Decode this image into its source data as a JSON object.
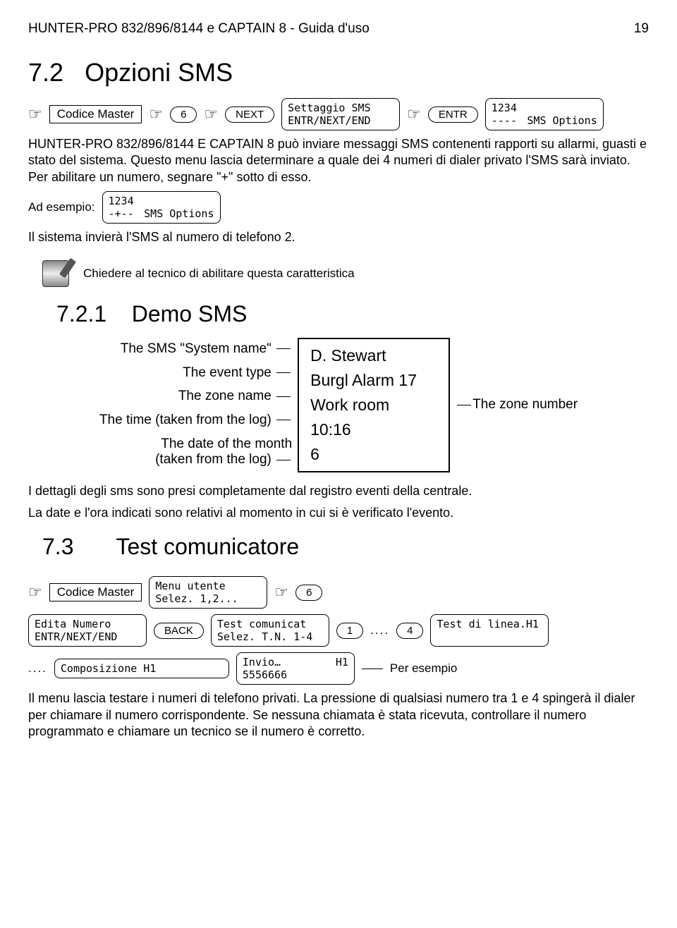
{
  "header": {
    "title": "HUNTER-PRO 832/896/8144 e CAPTAIN 8 - Guida d'uso",
    "page": "19"
  },
  "s72": {
    "heading_num": "7.2",
    "heading_text": "Opzioni SMS",
    "codice_master": "Codice Master",
    "key6": "6",
    "keyNext": "NEXT",
    "lcd1_line1": "Settaggio SMS",
    "lcd1_line2": "ENTR/NEXT/END",
    "keyEntr": "ENTR",
    "lcd2_line1": "1234",
    "lcd2_line2a": "----",
    "lcd2_line2b": "SMS Options",
    "para1": "HUNTER-PRO 832/896/8144 E CAPTAIN 8 può inviare messaggi SMS contenenti rapporti su allarmi, guasti e stato del sistema. Questo menu lascia determinare a quale dei 4 numeri di dialer privato l'SMS sarà inviato. Per abilitare un numero, segnare \"+\" sotto di esso.",
    "ad_esempio": "Ad esempio:",
    "lcd3_line1": "1234",
    "lcd3_line2a": "-+--",
    "lcd3_line2b": "SMS Options",
    "para2": "Il sistema invierà l'SMS al numero di telefono 2.",
    "note": "Chiedere al tecnico di abilitare questa caratteristica"
  },
  "s721": {
    "heading_num": "7.2.1",
    "heading_text": "Demo SMS",
    "demo": {
      "left": [
        "The SMS \"System name\"",
        "The event type",
        "The zone name",
        "The time (taken from the log)",
        "The date of the month\n(taken from the log)"
      ],
      "box": [
        "D. Stewart",
        "Burgl Alarm 17",
        "Work room",
        "10:16",
        "6"
      ],
      "right": "The zone number"
    },
    "para1": "I dettagli degli sms sono presi completamente dal registro eventi della centrale.",
    "para2": "La date e l'ora indicati sono relativi al momento in cui si è verificato l'evento."
  },
  "s73": {
    "heading_num": "7.3",
    "heading_text": "Test comunicatore",
    "codice_master": "Codice Master",
    "lcd1_line1": "Menu utente",
    "lcd1_line2": "Selez. 1,2...",
    "key6": "6",
    "lcd2_line1": "Edita Numero",
    "lcd2_line2": "ENTR/NEXT/END",
    "keyBack": "BACK",
    "lcd3_line1": "Test comunicat",
    "lcd3_line2": "Selez. T.N. 1-4",
    "key1": "1",
    "dots1": "....",
    "key4": "4",
    "lcd4_line1": "Test di linea.H1",
    "dots2": "....",
    "lcd5_line1": "Composizione H1",
    "lcd6_line1a": "Invio…",
    "lcd6_line1b": "H1",
    "lcd6_line2": "5556666",
    "per_esempio": "Per esempio",
    "para": "Il menu lascia testare i numeri di telefono privati. La pressione di qualsiasi numero tra 1 e 4 spingerà il dialer per chiamare il numero corrispondente. Se nessuna chiamata è stata ricevuta, controllare il numero programmato e chiamare un tecnico se il numero è corretto."
  }
}
